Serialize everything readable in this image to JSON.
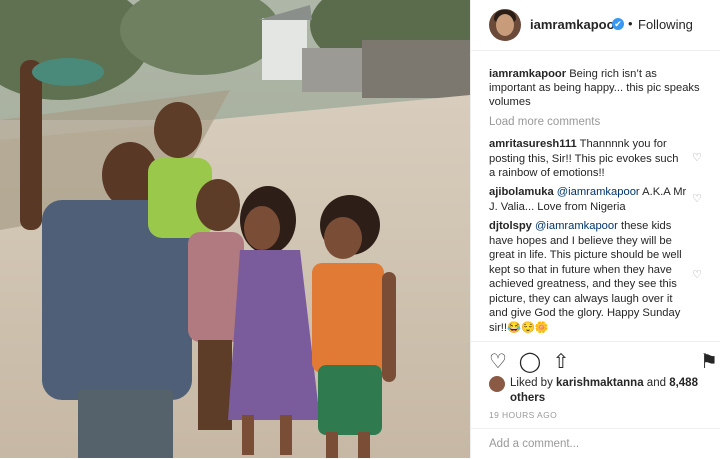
{
  "post": {
    "username": "iamramkapoor",
    "dot": "•",
    "follow_state": "Following",
    "caption_user": "iamramkapoor",
    "caption_text": " Being rich isn’t as important as being happy... this pic speaks volumes",
    "load_more": "Load more comments",
    "comments": [
      {
        "user": "amritasuresh111",
        "text": " Thannnnk you for posting this, Sir!! This pic evokes such a rainbow of emotions!!"
      },
      {
        "user": "ajibolamuka",
        "mention": " @iamramkapoor",
        "text": " A.K.A Mr J. Valia... Love from Nigeria"
      },
      {
        "user": "djtolspy",
        "mention": " @iamramkapoor",
        "text": " these kids have hopes and I believe they will be great in life. This picture should be well kept so that in future when they have achieved greatness, and they see this picture, they can always laugh over it and give God the glory. Happy Sunday sir!!😂😌🌼"
      }
    ],
    "likes_prefix": "Liked by ",
    "likes_user": "karishmaktanna",
    "likes_mid": " and ",
    "likes_count": "8,488 others",
    "timestamp": "19 HOURS AGO",
    "add_comment_placeholder": "Add a comment..."
  },
  "icons": {
    "verified": "✔",
    "heart": "♡",
    "like": "♡",
    "comment": "◯",
    "share": "⇧",
    "save": "⚑"
  },
  "colors": {
    "accent": "#3897f0",
    "mention": "#003569",
    "muted": "#999999"
  }
}
